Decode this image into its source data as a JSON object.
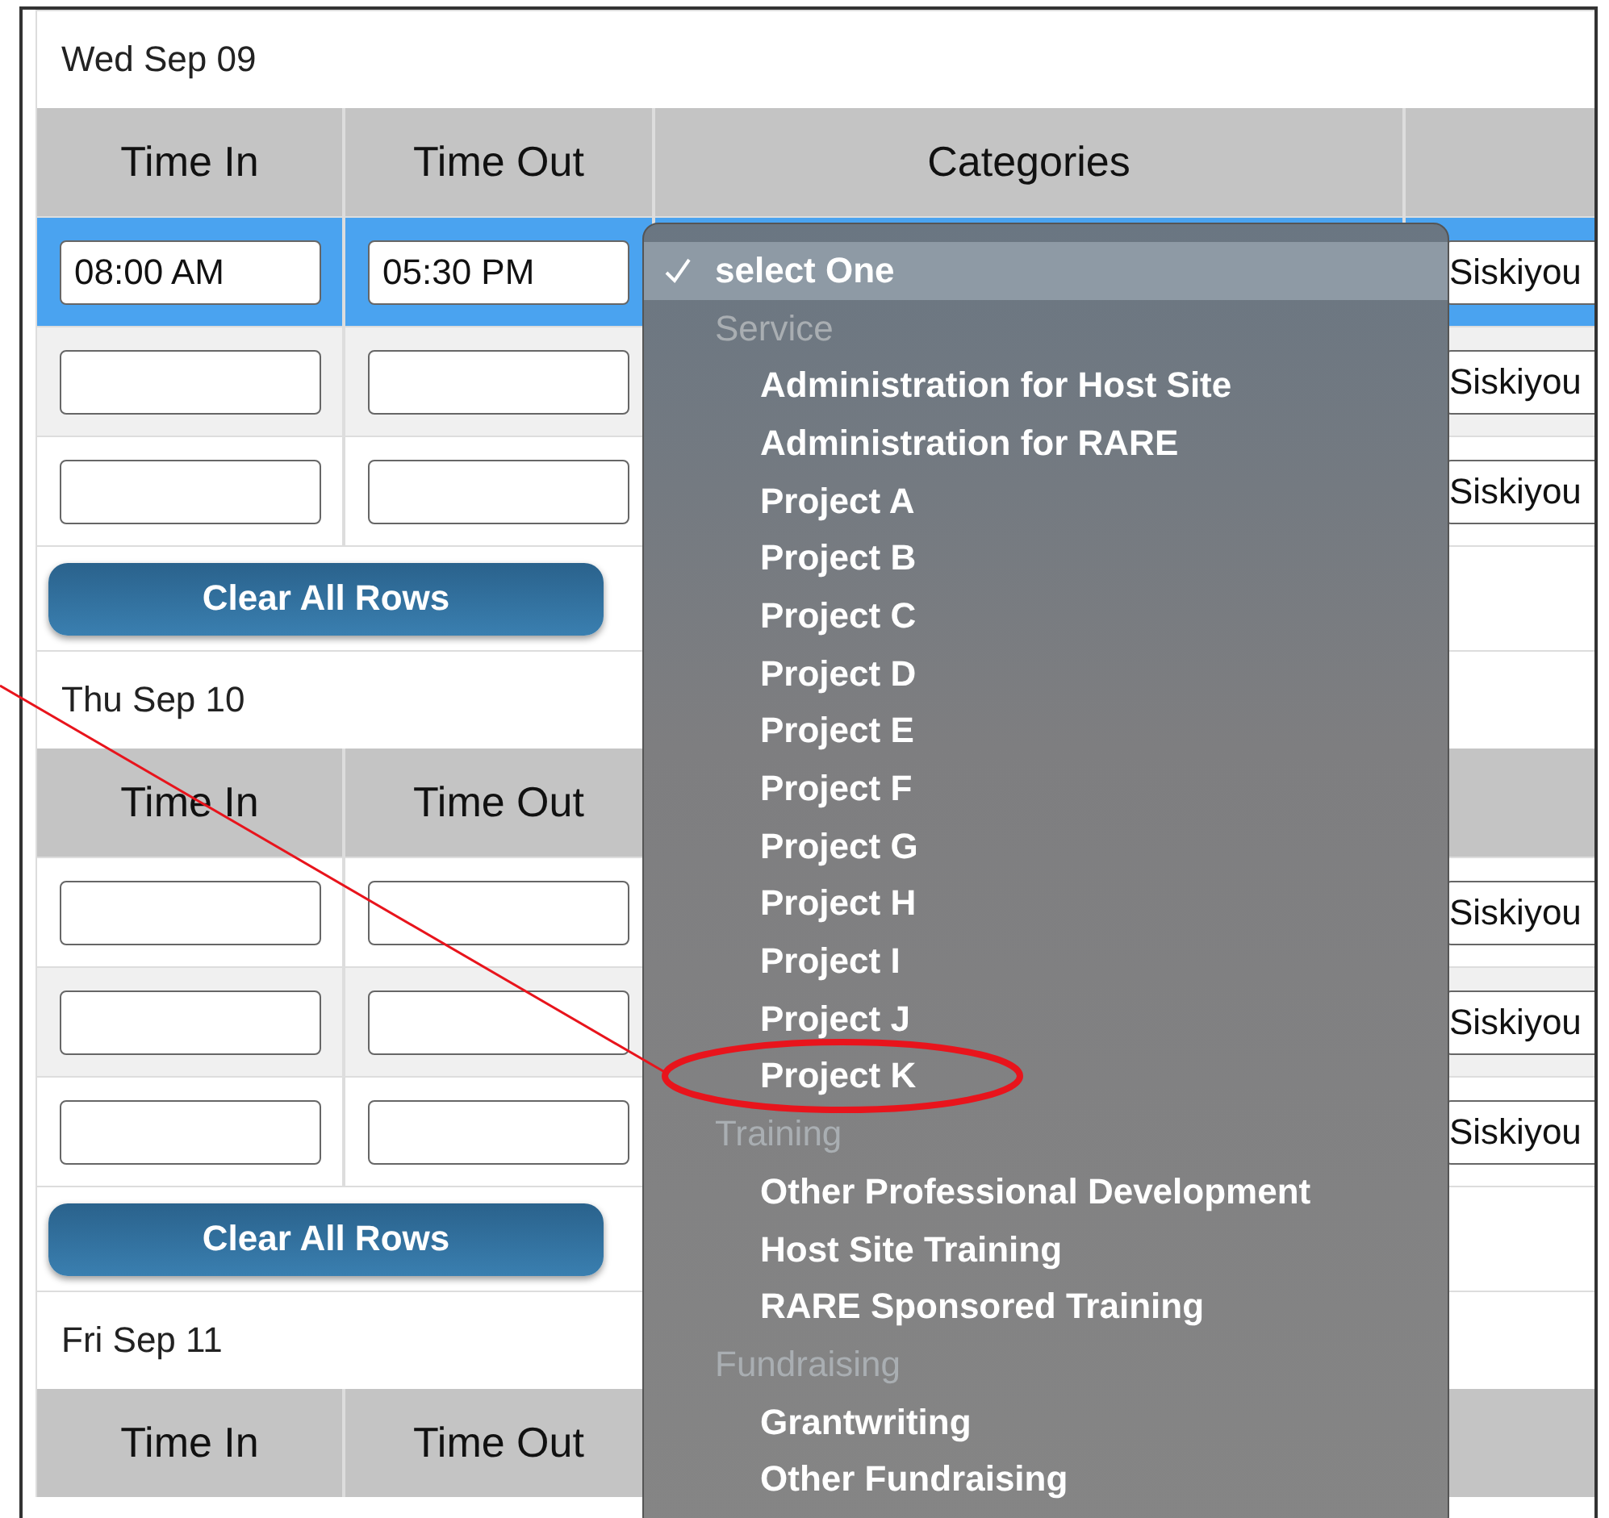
{
  "days": [
    {
      "date": "Wed Sep 09",
      "columns": [
        "Time In",
        "Time Out",
        "Categories"
      ],
      "rows": [
        {
          "time_in": "08:00 AM",
          "time_out": "05:30 PM",
          "location": "Siskiyou",
          "selected": true
        },
        {
          "location": "Siskiyou",
          "selected": false
        },
        {
          "location": "Siskiyou",
          "selected": false
        }
      ],
      "button": "Clear All Rows"
    },
    {
      "date": "Thu Sep 10",
      "columns": [
        "Time In",
        "Time Out"
      ],
      "rows": [
        {
          "location": "Siskiyou",
          "selected": false
        },
        {
          "location": "Siskiyou",
          "selected": false
        },
        {
          "location": "Siskiyou",
          "selected": false
        }
      ],
      "button": "Clear All Rows"
    },
    {
      "date": "Fri Sep 11",
      "columns": [
        "Time In",
        "Time Out"
      ]
    }
  ],
  "dropdown": {
    "items": [
      {
        "kind": "option",
        "label": "select One",
        "selected": true,
        "highlighted": false
      },
      {
        "kind": "group",
        "label": "Service"
      },
      {
        "kind": "option",
        "label": "Administration for Host Site",
        "selected": false,
        "highlighted": false
      },
      {
        "kind": "option",
        "label": "Administration for RARE",
        "selected": false,
        "highlighted": false
      },
      {
        "kind": "option",
        "label": "Project A",
        "selected": false,
        "highlighted": false
      },
      {
        "kind": "option",
        "label": "Project B",
        "selected": false,
        "highlighted": false
      },
      {
        "kind": "option",
        "label": "Project C",
        "selected": false,
        "highlighted": false
      },
      {
        "kind": "option",
        "label": "Project D",
        "selected": false,
        "highlighted": false
      },
      {
        "kind": "option",
        "label": "Project E",
        "selected": false,
        "highlighted": false
      },
      {
        "kind": "option",
        "label": "Project F",
        "selected": false,
        "highlighted": false
      },
      {
        "kind": "option",
        "label": "Project G",
        "selected": false,
        "highlighted": false
      },
      {
        "kind": "option",
        "label": "Project H",
        "selected": false,
        "highlighted": false
      },
      {
        "kind": "option",
        "label": "Project I",
        "selected": false,
        "highlighted": false
      },
      {
        "kind": "option",
        "label": "Project J",
        "selected": false,
        "highlighted": false
      },
      {
        "kind": "option",
        "label": "Project K",
        "selected": false,
        "highlighted": true
      },
      {
        "kind": "group",
        "label": "Training"
      },
      {
        "kind": "option",
        "label": "Other Professional Development",
        "selected": false,
        "highlighted": false
      },
      {
        "kind": "option",
        "label": "Host Site Training",
        "selected": false,
        "highlighted": false
      },
      {
        "kind": "option",
        "label": "RARE Sponsored Training",
        "selected": false,
        "highlighted": false
      },
      {
        "kind": "group",
        "label": "Fundraising"
      },
      {
        "kind": "option",
        "label": "Grantwriting",
        "selected": false,
        "highlighted": false
      },
      {
        "kind": "option",
        "label": "Other Fundraising",
        "selected": false,
        "highlighted": false
      }
    ]
  }
}
